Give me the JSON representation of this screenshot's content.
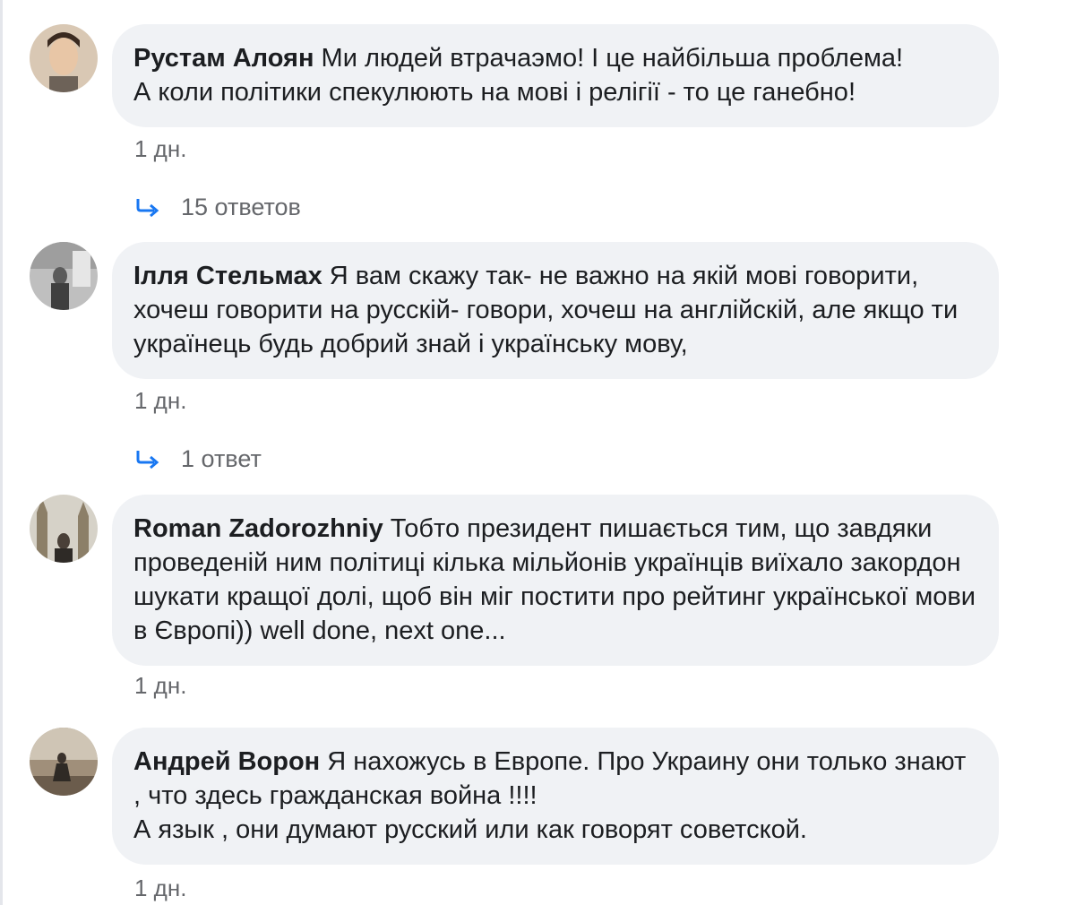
{
  "comments": [
    {
      "author": "Рустам Алоян",
      "text": "Ми людей втрачаэмо! І це найбільша проблема!\nА коли політики спекулюють на мові і релігії - то це ганебно!",
      "time": "1 дн.",
      "replies": "15 ответов"
    },
    {
      "author": "Ілля Стельмах",
      "text": "Я вам скажу так- не важно на якій мові говорити, хочеш говорити на русскій- говори, хочеш на англійскій, але якщо ти українець будь добрий знай і українську мову,",
      "time": "1 дн.",
      "replies": "1 ответ"
    },
    {
      "author": "Roman Zadorozhniy",
      "text": "Тобто президент пишається тим, що завдяки проведеній ним політиці кілька мільйонів українців виїхало закордон шукати кращої долі, щоб він міг постити про рейтинг української мови в Європі)) well done, next one...",
      "time": "1 дн."
    },
    {
      "author": "Андрей Ворон",
      "text": "Я нахожусь в Европе. Про Украину они только знают , что здесь гражданская война !!!!\nА язык , они думают русский или как говорят советской.",
      "time": "1 дн."
    }
  ],
  "colors": {
    "bubble": "#f0f2f5",
    "text": "#1c1e21",
    "meta": "#65676b",
    "reply_arrow": "#1877f2"
  },
  "icons": {
    "reply": "reply-arrow-icon"
  }
}
